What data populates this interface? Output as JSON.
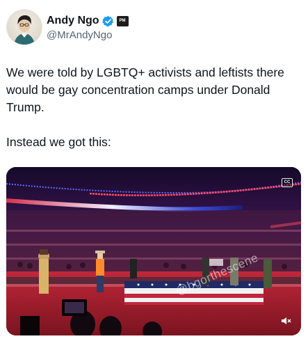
{
  "author": {
    "display_name": "Andy Ngo",
    "handle": "@MrAndyNgo",
    "affiliate_badge": "PM"
  },
  "tweet": {
    "paragraphs": [
      "We were told by LGBTQ+ activists and leftists there would be gay concentration camps under Donald Trump.",
      "Instead we got this:"
    ]
  },
  "media": {
    "cc_label": "CC",
    "watermark": "@bgorthescene"
  },
  "icons": {
    "verified": "verified-check-icon",
    "cc": "closed-captions-icon",
    "mute": "speaker-muted-icon"
  },
  "colors": {
    "verified_blue": "#1d9bf0",
    "secondary_text": "#536471"
  }
}
